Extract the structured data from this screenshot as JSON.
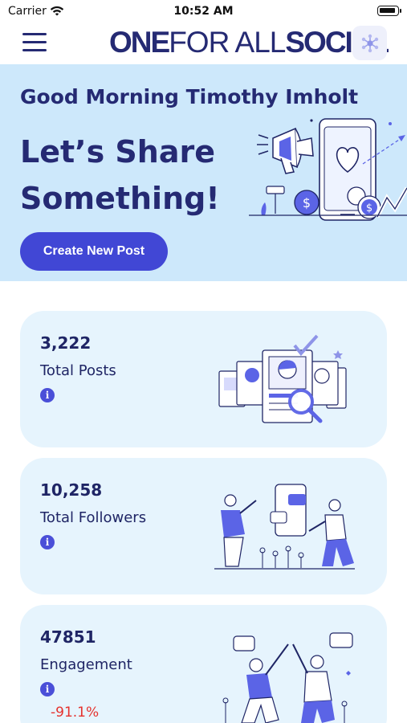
{
  "status_bar": {
    "carrier": "Carrier",
    "time": "10:52 AM"
  },
  "header": {
    "logo_part1": "ONE",
    "logo_part2": "FOR ALL",
    "logo_part3": "SOCIAL",
    "menu_icon": "hamburger-icon",
    "share_icon": "network-share-icon"
  },
  "hero": {
    "greeting": "Good Morning Timothy Imholt",
    "title": "Let’s Share Something!",
    "cta_label": "Create New Post"
  },
  "stats": [
    {
      "value": "3,222",
      "label": "Total Posts",
      "change": ""
    },
    {
      "value": "10,258",
      "label": "Total Followers",
      "change": ""
    },
    {
      "value": "47851",
      "label": "Engagement",
      "change": "-91.1%"
    }
  ],
  "colors": {
    "brand": "#252a73",
    "accent": "#4147d5",
    "hero_bg": "#cde8fb",
    "card_bg": "#e6f4fd",
    "negative": "#e5322e"
  }
}
